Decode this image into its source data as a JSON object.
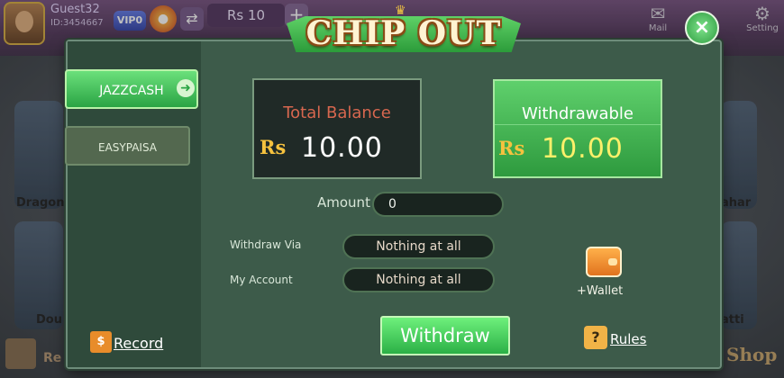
{
  "top_bar": {
    "username": "Guest32",
    "user_id": "ID:3454667",
    "vip_label": "VIP0",
    "balance": "Rs  10",
    "add_glyph": "+",
    "mail_label": "Mail",
    "settings_label": "Setting"
  },
  "lobby": {
    "games": [
      "Dragon",
      "ahar",
      "Dou",
      "atti"
    ],
    "recharge_label": "Re",
    "shop_label": "Shop"
  },
  "dialog": {
    "title": "CHIP OUT",
    "close_glyph": "×",
    "tabs": [
      {
        "label": "JAZZCASH",
        "selected": true
      },
      {
        "label": "EASYPAISA",
        "selected": false
      }
    ],
    "total_balance": {
      "label": "Total Balance",
      "currency": "Rs",
      "amount": "10.00"
    },
    "withdrawable": {
      "label": "Withdrawable",
      "currency": "Rs",
      "amount": "10.00"
    },
    "form": {
      "amount_label": "Amount",
      "amount_value": "0",
      "withdraw_via_label": "Withdraw Via",
      "withdraw_via_value": "Nothing at all",
      "my_account_label": "My Account",
      "my_account_value": "Nothing at all"
    },
    "wallet_label": "+Wallet",
    "withdraw_button": "Withdraw",
    "record_label": "Record",
    "rules_label": "Rules"
  },
  "colors": {
    "accent_green": "#2aa444",
    "panel_bg": "#3d5b4a",
    "total_label": "#d7674f",
    "amount_yellow": "#fdf06a"
  },
  "icons": [
    "avatar",
    "chip-icon",
    "refresh-icon",
    "mail-icon",
    "settings-icon",
    "close-icon",
    "arrow-icon",
    "wallet-icon",
    "record-icon",
    "rules-icon",
    "gift-icon",
    "crown-icon"
  ]
}
